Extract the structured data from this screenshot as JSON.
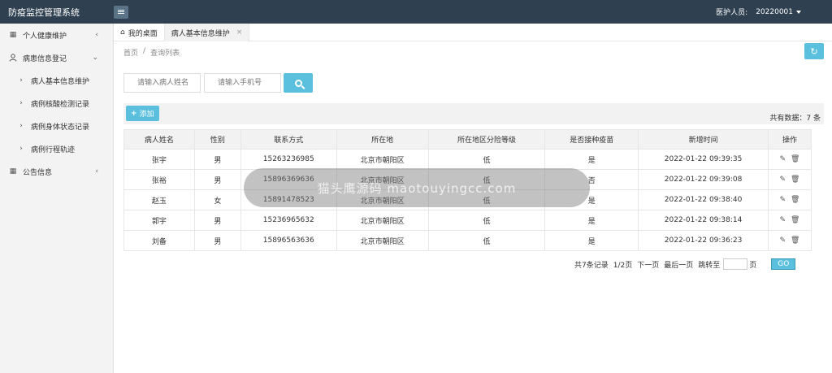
{
  "app": {
    "title": "防疫监控管理系统"
  },
  "header": {
    "user_label": "医护人员:",
    "user_id": "20220001"
  },
  "sidebar": {
    "items": [
      {
        "label": "个人健康维护",
        "icon": "calendar-icon",
        "chevron": "‹"
      },
      {
        "label": "病患信息登记",
        "icon": "person-icon",
        "chevron": "⌄"
      },
      {
        "label": "病人基本信息维护",
        "icon": "chevron-right-icon"
      },
      {
        "label": "病例核酸检测记录",
        "icon": "chevron-right-icon"
      },
      {
        "label": "病例身体状态记录",
        "icon": "chevron-right-icon"
      },
      {
        "label": "病例行程轨迹",
        "icon": "chevron-right-icon"
      },
      {
        "label": "公告信息",
        "icon": "grid-icon",
        "chevron": "‹"
      }
    ]
  },
  "tabs": [
    {
      "label": "我的桌面",
      "icon": "home-icon"
    },
    {
      "label": "病人基本信息维护",
      "close": "×"
    }
  ],
  "breadcrumb": {
    "home": "首页",
    "sep": "/",
    "current": "查询列表"
  },
  "search": {
    "name_placeholder": "请输入病人姓名",
    "phone_placeholder": "请输入手机号"
  },
  "toolbar": {
    "add_label": "添加",
    "add_plus": "+",
    "total": "共有数据：7 条"
  },
  "table": {
    "headers": [
      "病人姓名",
      "性别",
      "联系方式",
      "所在地",
      "所在地区分险等级",
      "是否接种疫苗",
      "新增时间",
      "操作"
    ],
    "rows": [
      [
        "张宇",
        "男",
        "15263236985",
        "北京市朝阳区",
        "低",
        "是",
        "2022-01-22 09:39:35"
      ],
      [
        "张裕",
        "男",
        "15896369636",
        "北京市朝阳区",
        "低",
        "否",
        "2022-01-22 09:39:08"
      ],
      [
        "赵玉",
        "女",
        "15891478523",
        "北京市朝阳区",
        "低",
        "是",
        "2022-01-22 09:38:40"
      ],
      [
        "郭宇",
        "男",
        "15236965632",
        "北京市朝阳区",
        "低",
        "是",
        "2022-01-22 09:38:14"
      ],
      [
        "刘备",
        "男",
        "15896563636",
        "北京市朝阳区",
        "低",
        "是",
        "2022-01-22 09:36:23"
      ]
    ]
  },
  "pager": {
    "records": "共7条记录",
    "page": "1/2页",
    "next": "下一页",
    "last": "最后一页",
    "jump": "跳转至",
    "page_unit": "页",
    "go": "GO"
  },
  "overlay_text": "猫头鹰源码 maotouyingcc.com",
  "colors": {
    "topbar": "#2f4050",
    "accent": "#5bc0de",
    "sidebar_bg": "#f3f3f3"
  }
}
